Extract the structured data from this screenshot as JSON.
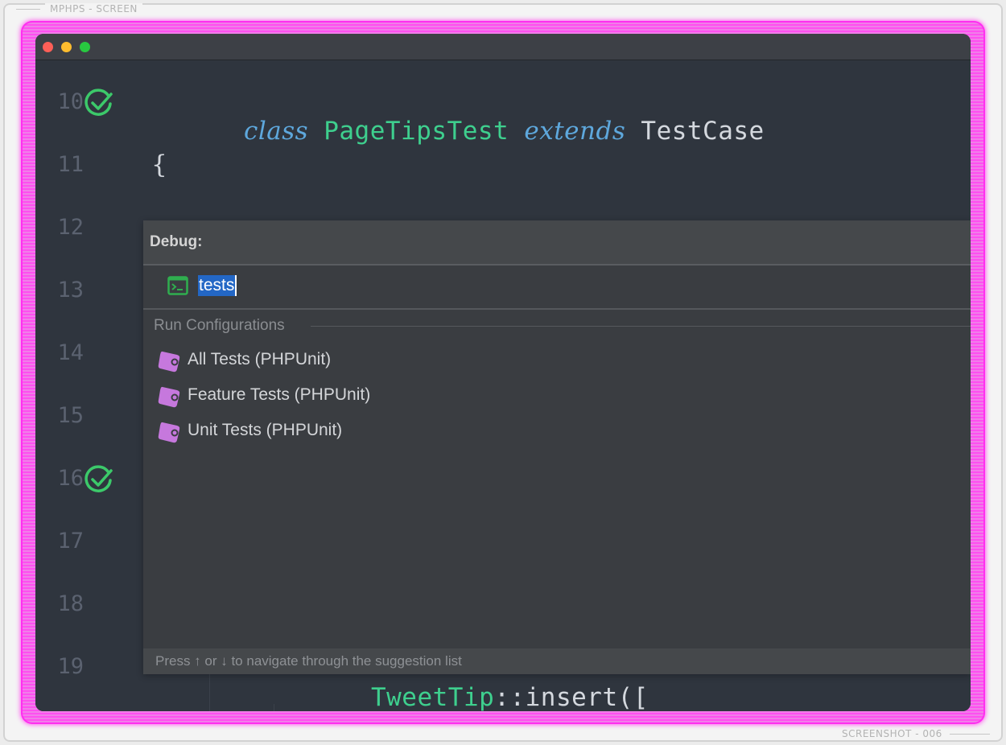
{
  "frame": {
    "top_label": "MPHPS - SCREEN",
    "bottom_label": "SCREENSHOT - 006"
  },
  "window_controls": [
    "close",
    "minimize",
    "maximize"
  ],
  "editor": {
    "lines": [
      {
        "number": "10",
        "has_check": true
      },
      {
        "number": "11",
        "has_check": false
      },
      {
        "number": "12",
        "has_check": false
      },
      {
        "number": "13",
        "has_check": false
      },
      {
        "number": "14",
        "has_check": false
      },
      {
        "number": "15",
        "has_check": false
      },
      {
        "number": "16",
        "has_check": true
      },
      {
        "number": "17",
        "has_check": false
      },
      {
        "number": "18",
        "has_check": false
      },
      {
        "number": "19",
        "has_check": false
      }
    ],
    "line10": {
      "kw1": "class",
      "name": "PageTipsTest",
      "kw2": "extends",
      "parent": "TestCase"
    },
    "line11": {
      "brace": "{"
    },
    "line19": {
      "cls": "TweetTip",
      "rest": "::insert(["
    }
  },
  "popup": {
    "title": "Debug:",
    "input_value": "tests",
    "section_label": "Run Configurations",
    "items": [
      {
        "label": "All Tests (PHPUnit)",
        "icon": "phpunit-icon"
      },
      {
        "label": "Feature Tests (PHPUnit)",
        "icon": "phpunit-icon"
      },
      {
        "label": "Unit Tests (PHPUnit)",
        "icon": "phpunit-icon"
      }
    ],
    "footer": "Press ↑ or ↓ to navigate through the suggestion list"
  },
  "colors": {
    "neon": "#ff4ff0",
    "check": "#3cc96a",
    "keyword": "#5ea8dd",
    "class_name": "#3ecf8e",
    "selection": "#2367c5",
    "phpunit_icon": "#c678dd"
  }
}
